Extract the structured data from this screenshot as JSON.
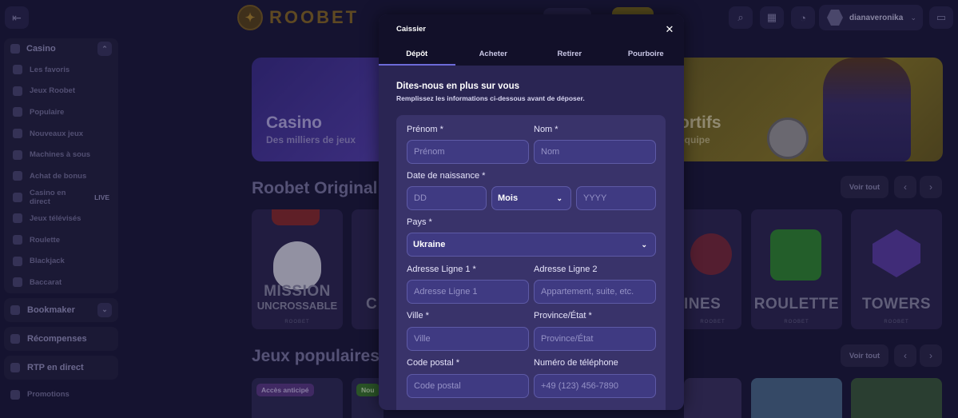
{
  "header": {
    "logo_text": "ROOBET",
    "username": "dianaveronika"
  },
  "sidebar": {
    "casino_label": "Casino",
    "casino_items": [
      {
        "label": "Les favoris"
      },
      {
        "label": "Jeux Roobet"
      },
      {
        "label": "Populaire"
      },
      {
        "label": "Nouveaux jeux"
      },
      {
        "label": "Machines à sous"
      },
      {
        "label": "Achat de bonus"
      },
      {
        "label": "Casino en direct",
        "badge": "LIVE"
      },
      {
        "label": "Jeux télévisés"
      },
      {
        "label": "Roulette"
      },
      {
        "label": "Blackjack"
      },
      {
        "label": "Baccarat"
      }
    ],
    "bookmaker_label": "Bookmaker",
    "rewards_label": "Récompenses",
    "rtp_label": "RTP en direct",
    "promotions_label": "Promotions"
  },
  "banners": {
    "casino_title": "Casino",
    "casino_sub": "Des milliers de jeux",
    "sport_title": "ortifs",
    "sport_sub": "équipe"
  },
  "sections": {
    "originals_title": "Roobet Original",
    "popular_title": "Jeux populaires",
    "see_all": "Voir tout"
  },
  "games": {
    "mission_line1": "MISSION",
    "mission_line2": "UNCROSSABLE",
    "partial_c": "C",
    "mines": "INES",
    "roulette": "ROULETTE",
    "towers": "TOWERS",
    "brand": "ROOBET"
  },
  "popular": {
    "early_access": "Accès anticipé",
    "new_badge": "Nou"
  },
  "modal": {
    "title": "Caissier",
    "tabs": [
      "Dépôt",
      "Acheter",
      "Retirer",
      "Pourboire"
    ],
    "heading": "Dites-nous en plus sur vous",
    "subheading": "Remplissez les informations ci-dessous avant de déposer.",
    "fields": {
      "first_name": {
        "label": "Prénom *",
        "placeholder": "Prénom"
      },
      "last_name": {
        "label": "Nom *",
        "placeholder": "Nom"
      },
      "dob": {
        "label": "Date de naissance *",
        "day_placeholder": "DD",
        "month_value": "Mois",
        "year_placeholder": "YYYY"
      },
      "country": {
        "label": "Pays *",
        "value": "Ukraine"
      },
      "address1": {
        "label": "Adresse Ligne 1 *",
        "placeholder": "Adresse Ligne 1"
      },
      "address2": {
        "label": "Adresse Ligne 2",
        "placeholder": "Appartement, suite, etc."
      },
      "city": {
        "label": "Ville *",
        "placeholder": "Ville"
      },
      "province": {
        "label": "Province/État *",
        "placeholder": "Province/État"
      },
      "postal": {
        "label": "Code postal *",
        "placeholder": "Code postal"
      },
      "phone": {
        "label": "Numéro de téléphone",
        "placeholder": "+49 (123) 456-7890"
      }
    }
  }
}
